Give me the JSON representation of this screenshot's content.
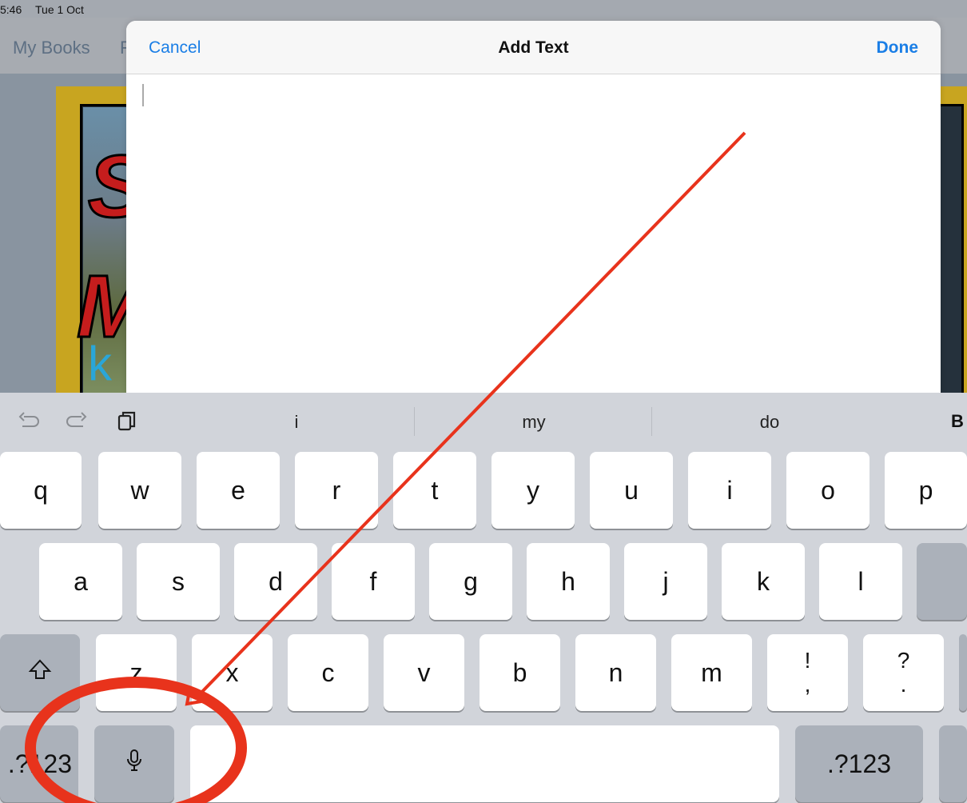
{
  "status": {
    "time": "5:46",
    "date": "Tue 1 Oct"
  },
  "background_nav": {
    "my_books": "My Books",
    "partial": "F"
  },
  "dialog": {
    "cancel": "Cancel",
    "title": "Add Text",
    "done": "Done"
  },
  "shortcuts": {
    "undo_icon": "undo-icon",
    "redo_icon": "redo-icon",
    "paste_icon": "paste-icon",
    "suggestions": [
      "i",
      "my",
      "do"
    ],
    "bold": "B"
  },
  "keys": {
    "row1": [
      "q",
      "w",
      "e",
      "r",
      "t",
      "y",
      "u",
      "i",
      "o",
      "p"
    ],
    "row2": [
      "a",
      "s",
      "d",
      "f",
      "g",
      "h",
      "j",
      "k",
      "l"
    ],
    "row3": [
      "z",
      "x",
      "c",
      "v",
      "b",
      "n",
      "m"
    ],
    "row3_punct": [
      {
        "top": "!",
        "bottom": ","
      },
      {
        "top": "?",
        "bottom": "."
      }
    ],
    "numbers_left": ".?123",
    "numbers_right": ".?123",
    "shift_icon": "shift-icon",
    "mic_icon": "microphone-icon"
  },
  "annotation": {
    "color": "#e8331c",
    "shapes": [
      "arrow",
      "circle"
    ]
  }
}
